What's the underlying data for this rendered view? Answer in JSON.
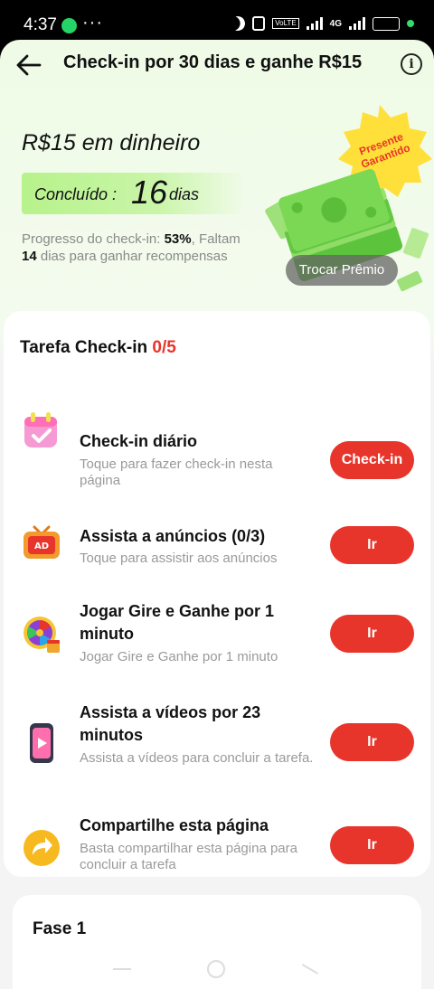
{
  "status_bar": {
    "time": "4:37",
    "dots": "···",
    "volte": "VoLTE",
    "network": "4G",
    "battery": "58"
  },
  "header": {
    "title": "Check-in por 30 dias e ganhe R$15"
  },
  "hero": {
    "title": "R$15 em dinheiro",
    "done_label": "Concluído :",
    "done_days": "16",
    "done_unit": "dias",
    "progress_prefix": "Progresso do check-in: ",
    "progress_percent": "53%",
    "progress_mid": ", Faltam ",
    "days_left": "14",
    "progress_suffix": " dias para ganhar recompensas",
    "badge": "Presente Garantido",
    "swap_button": "Trocar Prêmio"
  },
  "tasks": {
    "heading": "Tarefa Check-in",
    "count": "0/5",
    "items": [
      {
        "title": "Check-in diário",
        "desc": "Toque para fazer check-in nesta página",
        "button": "Check-in",
        "icon": "calendar-icon"
      },
      {
        "title": "Assista a anúncios  (0/3)",
        "desc": "Toque para assistir aos anúncios",
        "button": "Ir",
        "icon": "tv-ad-icon"
      },
      {
        "title": "Jogar Gire e Ganhe por 1 minuto",
        "desc": "Jogar Gire e Ganhe por 1 minuto",
        "button": "Ir",
        "icon": "prize-wheel-icon"
      },
      {
        "title": "Assista a vídeos por 23 minutos",
        "desc": "Assista a vídeos para concluir a tarefa.",
        "button": "Ir",
        "icon": "phone-video-icon"
      },
      {
        "title": "Compartilhe esta página",
        "desc": "Basta compartilhar esta página para concluir a tarefa",
        "button": "Ir",
        "icon": "share-arrow-icon"
      }
    ]
  },
  "phase": {
    "title": "Fase 1"
  },
  "colors": {
    "accent": "#e8352b",
    "pill": "#b7f28b"
  }
}
